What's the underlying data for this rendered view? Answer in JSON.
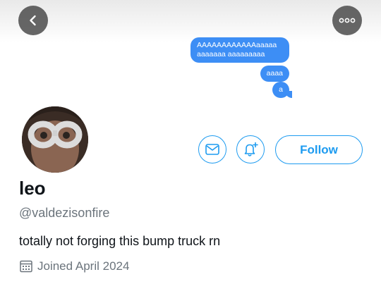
{
  "header": {
    "back_icon": "chevron-left-icon",
    "more_icon": "more-horizontal-icon"
  },
  "banner": {
    "messages": [
      "AAAAAAAAAAAAaaaaa aaaaaaa aaaaaaaaa",
      "aaaa",
      "a"
    ]
  },
  "profile": {
    "display_name": "leo",
    "handle": "@valdezisonfire",
    "bio": "totally not forging this bump truck rn",
    "joined": "Joined April 2024"
  },
  "actions": {
    "message_icon": "mail-icon",
    "notify_icon": "bell-plus-icon",
    "follow_label": "Follow"
  },
  "colors": {
    "accent": "#1d9bf0",
    "bubble": "#3d8ef5",
    "secondary_text": "#6b747c"
  }
}
